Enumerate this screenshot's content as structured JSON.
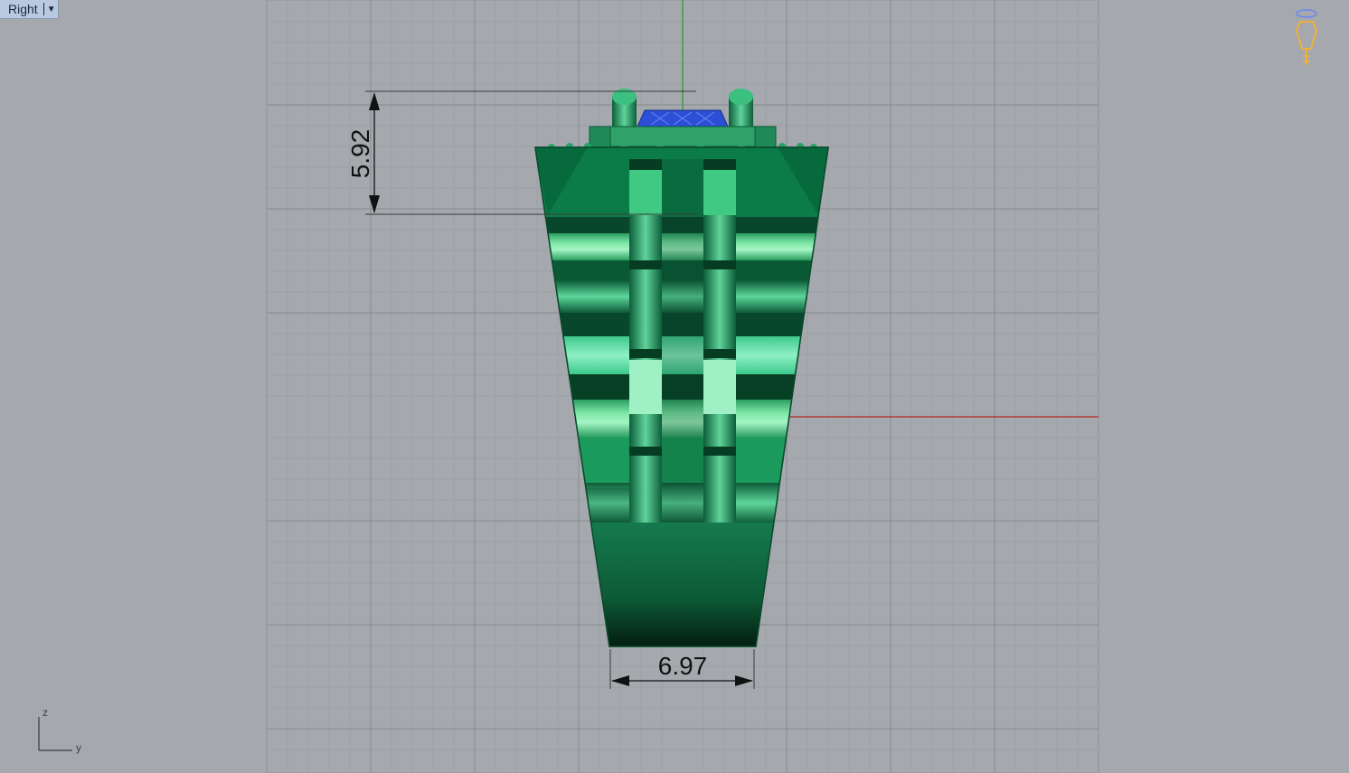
{
  "viewport": {
    "view_name": "Right",
    "menu_icon": "triangle-down-icon",
    "background_color": "#a5a8ad",
    "grid_color": "#9a9da2",
    "grid_major_color": "#8c9095"
  },
  "dimensions": {
    "vertical_value": "5.92",
    "horizontal_value": "6.97"
  },
  "axes": {
    "vertical_axis_label": "z",
    "horizontal_axis_label": "y",
    "x_axis_color": "#b03a3a",
    "y_axis_color": "#3c9a4a"
  },
  "model": {
    "body_color": "#1f9a5e",
    "highlight_color": "#7ee8b8",
    "gem_color": "#2b4fd6"
  },
  "gumball": {
    "icon": "light-bulb-icon",
    "color": "#f0b03a"
  }
}
